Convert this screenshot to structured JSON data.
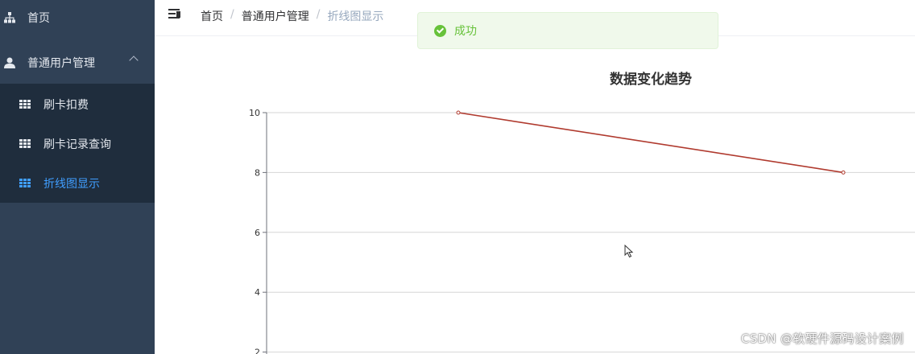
{
  "sidebar": {
    "home_label": "首页",
    "group_label": "普通用户管理",
    "items": [
      {
        "label": "刷卡扣费"
      },
      {
        "label": "刷卡记录查询"
      },
      {
        "label": "折线图显示"
      }
    ]
  },
  "header": {
    "breadcrumb": [
      "首页",
      "普通用户管理",
      "折线图显示"
    ],
    "separator": "/"
  },
  "toast": {
    "message": "成功",
    "type": "success"
  },
  "colors": {
    "sidebar_bg": "#304156",
    "submenu_bg": "#1f2d3d",
    "active": "#409eff",
    "line": "#b03a2e",
    "success": "#67c23a"
  },
  "chart_data": {
    "type": "line",
    "title": "数据变化趋势",
    "xlabel": "",
    "ylabel": "",
    "ytick_labels": [
      "10",
      "8",
      "6",
      "4",
      "2"
    ],
    "ylim": [
      2,
      10
    ],
    "grid": true,
    "series": [
      {
        "points": [
          {
            "y": 10
          },
          {
            "y": 8
          }
        ]
      }
    ]
  },
  "watermark": "CSDN @软硬件源码设计案例"
}
